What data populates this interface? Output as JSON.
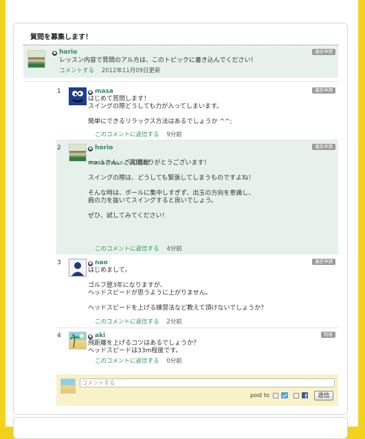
{
  "card_title": "質問を募集します！",
  "topic": {
    "user": "horio",
    "report": "違反申請",
    "text": "レッスン内容で質問のアル方は、このトピックに書き込んでください！",
    "comment_link": "コメントする",
    "updated": "2012年11月09日更新"
  },
  "comments": [
    {
      "num": "1",
      "user": "masa",
      "badge": "違反申請",
      "text": "はじめて質問します！\nスイングの際どうしても力が入ってしまいます。\n\n簡単にできるリラックス方法はあるでしょうか ^^;",
      "reply": "このコメントに返信する",
      "time": "9分前"
    },
    {
      "num": "2",
      "user": "horio",
      "badge": "違反申請",
      "reply_to_prefix": ">> 1 masa",
      "reply_to_suffix": " への返信",
      "text": "masaさん。ご質問ありがとうございます！\n\nスイングの際は、どうしても緊張してしまうものですよね！\n\nそんな時は、ボールに集中しすぎず、出玉の方向を意識し、\n肩の力を抜いてスイングすると良いでしょう。\n\nぜひ、試してみてください！",
      "reply": "このコメントに返信する",
      "time": "4分前"
    },
    {
      "num": "3",
      "user": "nao",
      "badge": "違反申請",
      "text": "はじめまして。\n\nゴルフ歴3年になりますが、\nヘッドスピードが思うように上がりません。\n\nヘッドスピードを上げる練習法など教えて頂けないでしょうか？",
      "reply": "このコメントに返信する",
      "time": "2分前"
    },
    {
      "num": "4",
      "user": "aki",
      "badge": "削除",
      "text": "飛距離を上げるコツはあるでしょうか？\nヘッドスピードは33m程度です。",
      "reply": "このコメントに返信する",
      "time": "0分前"
    }
  ],
  "compose": {
    "placeholder": "コメントする",
    "post_to": "post to",
    "send": "送信"
  },
  "icons": {
    "twitter": "twitter-icon",
    "facebook": "facebook-icon"
  }
}
